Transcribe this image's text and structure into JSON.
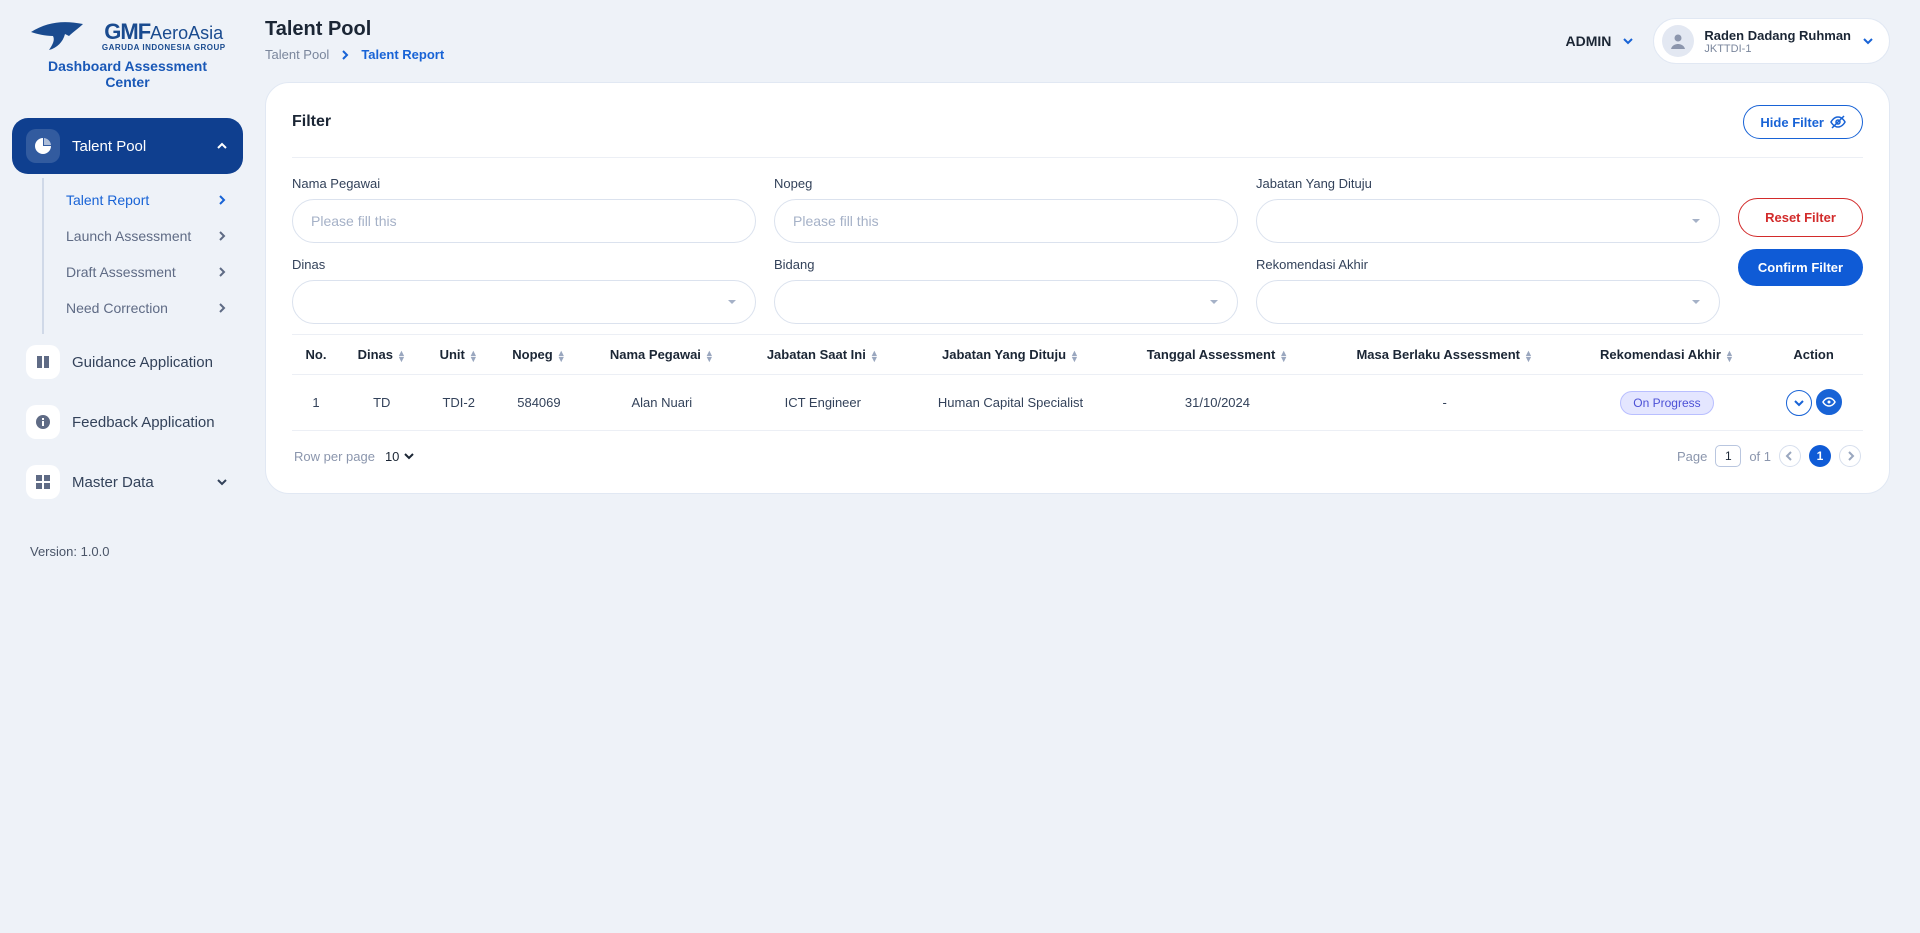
{
  "brand": {
    "name_main": "GMF",
    "name_sub": "AeroAsia",
    "tagline": "GARUDA INDONESIA GROUP",
    "app_title": "Dashboard Assessment Center"
  },
  "sidebar": {
    "items": [
      {
        "label": "Talent Pool",
        "icon": "pie-icon"
      },
      {
        "label": "Guidance Application",
        "icon": "book-icon"
      },
      {
        "label": "Feedback Application",
        "icon": "info-icon"
      },
      {
        "label": "Master Data",
        "icon": "grid-icon"
      }
    ],
    "sub_items": [
      {
        "label": "Talent Report"
      },
      {
        "label": "Launch Assessment"
      },
      {
        "label": "Draft Assessment"
      },
      {
        "label": "Need Correction"
      }
    ],
    "version": "Version: 1.0.0"
  },
  "header": {
    "title": "Talent Pool",
    "breadcrumb": [
      "Talent Pool",
      "Talent Report"
    ],
    "admin_label": "ADMIN",
    "user": {
      "name": "Raden Dadang Ruhman",
      "code": "JKTTDI-1"
    }
  },
  "filter": {
    "title": "Filter",
    "hide_label": "Hide Filter",
    "fields": {
      "nama_pegawai": {
        "label": "Nama Pegawai",
        "placeholder": "Please fill this"
      },
      "nopeg": {
        "label": "Nopeg",
        "placeholder": "Please fill this"
      },
      "jabatan_dituju": {
        "label": "Jabatan Yang Dituju"
      },
      "dinas": {
        "label": "Dinas"
      },
      "bidang": {
        "label": "Bidang"
      },
      "rekomendasi_akhir": {
        "label": "Rekomendasi Akhir"
      }
    },
    "reset_label": "Reset Filter",
    "confirm_label": "Confirm Filter"
  },
  "table": {
    "columns": [
      "No.",
      "Dinas",
      "Unit",
      "Nopeg",
      "Nama Pegawai",
      "Jabatan Saat Ini",
      "Jabatan Yang Dituju",
      "Tanggal Assessment",
      "Masa Berlaku Assessment",
      "Rekomendasi Akhir",
      "Action"
    ],
    "rows": [
      {
        "no": "1",
        "dinas": "TD",
        "unit": "TDI-2",
        "nopeg": "584069",
        "nama": "Alan Nuari",
        "jab_saat": "ICT Engineer",
        "jab_dituju": "Human Capital Specialist",
        "tgl": "31/10/2024",
        "masa": "-",
        "rekom": "On Progress"
      }
    ]
  },
  "footer": {
    "row_per_page_label": "Row per page",
    "row_per_page_value": "10",
    "page_label": "Page",
    "page_current": "1",
    "page_of": "of 1",
    "page_badge": "1"
  }
}
